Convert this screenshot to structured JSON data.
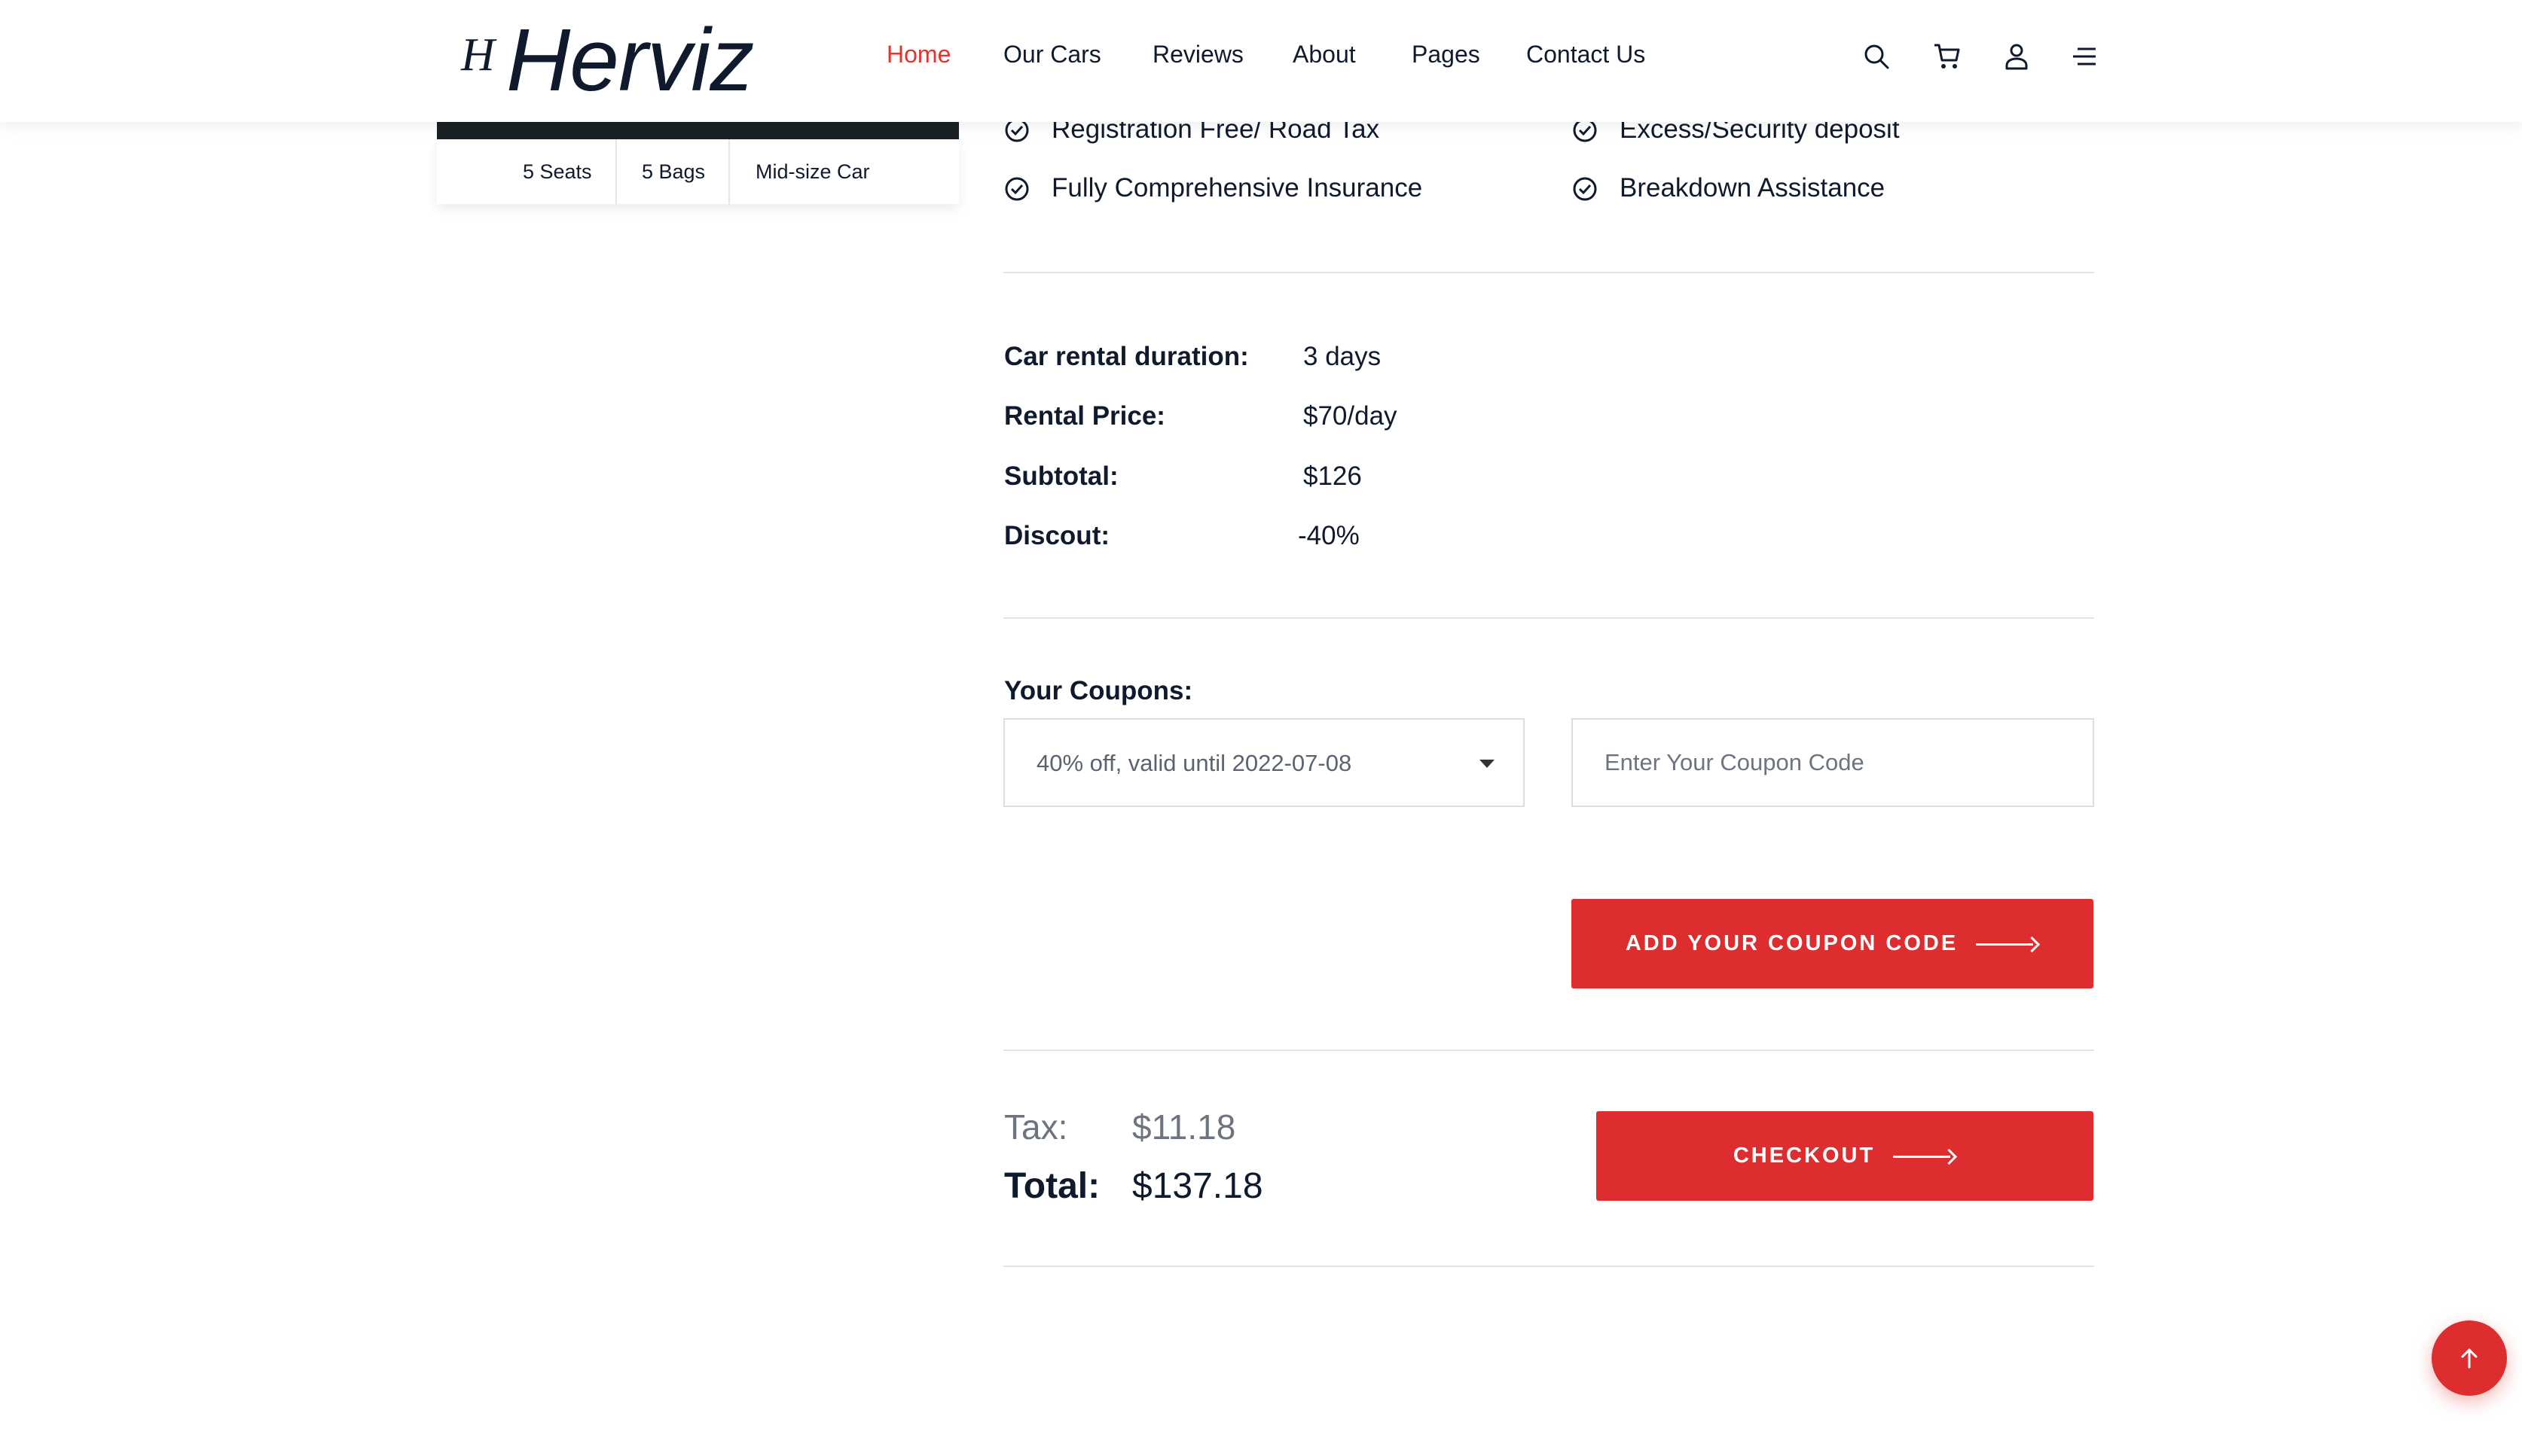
{
  "header": {
    "logo_small": "H",
    "logo_main": "Herviz",
    "nav": [
      {
        "label": "Home",
        "active": true
      },
      {
        "label": "Our Cars"
      },
      {
        "label": "Reviews"
      },
      {
        "label": "About"
      },
      {
        "label": "Pages"
      },
      {
        "label": "Contact Us"
      }
    ],
    "icons": [
      "search-icon",
      "cart-icon",
      "user-icon",
      "menu-icon"
    ]
  },
  "car": {
    "specs": [
      "5 Seats",
      "5 Bags",
      "Mid-size Car"
    ]
  },
  "features": [
    "Registration Free/ Road Tax",
    "Excess/Security deposit",
    "Fully Comprehensive Insurance",
    "Breakdown Assistance"
  ],
  "summary": {
    "duration_label": "Car rental duration:",
    "duration_value": "3 days",
    "price_label": "Rental Price:",
    "price_value": "$70/day",
    "subtotal_label": "Subtotal:",
    "subtotal_value": "$126",
    "discount_label": "Discout:",
    "discount_value": "-40%"
  },
  "coupons": {
    "title": "Your Coupons:",
    "selected": "40% off, valid until 2022-07-08",
    "input_placeholder": "Enter Your Coupon Code",
    "add_button": "ADD YOUR COUPON CODE"
  },
  "totals": {
    "tax_label": "Tax:",
    "tax_value": "$11.18",
    "total_label": "Total:",
    "total_value": "$137.18",
    "checkout_button": "CHECKOUT"
  },
  "colors": {
    "accent": "#dd2d2e",
    "text": "#0f1b2d",
    "muted": "#6d7480"
  }
}
